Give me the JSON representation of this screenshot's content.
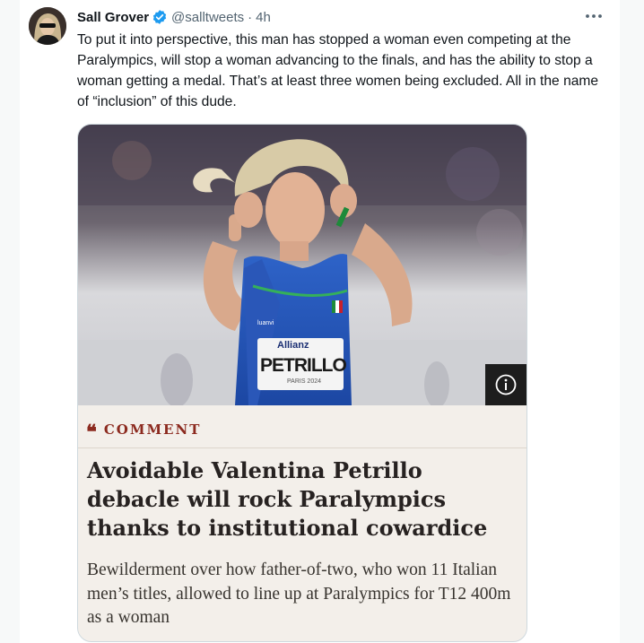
{
  "tweet": {
    "display_name": "Sall Grover",
    "handle": "@salltweets",
    "separator": "·",
    "time": "4h",
    "text": "To put it into perspective, this man has stopped a woman even competing at the Paralympics, will stop a woman advancing to the finals, and has the ability to stop a woman getting a medal. That’s at least three women being excluded. All in the name of “inclusion” of this dude."
  },
  "card": {
    "image": {
      "bib_sponsor": "Allianz",
      "bib_name": "PETRILLO",
      "bib_event": "PARIS 2024",
      "kit_brand": "luanvi"
    },
    "kicker": "COMMENT",
    "kicker_icon": "❝",
    "headline": "Avoidable Valentina Petrillo debacle will rock Paralympics thanks to institutional cowardice",
    "standfirst": "Bewilderment over how father-of-two, who won 11 Italian men’s titles, allowed to line up at Paralympics for T12 400m as a woman"
  },
  "colors": {
    "verified": "#1d9bf0",
    "kicker": "#8c2a1f",
    "card_bg": "#f3efea",
    "secondary_text": "#536471"
  }
}
